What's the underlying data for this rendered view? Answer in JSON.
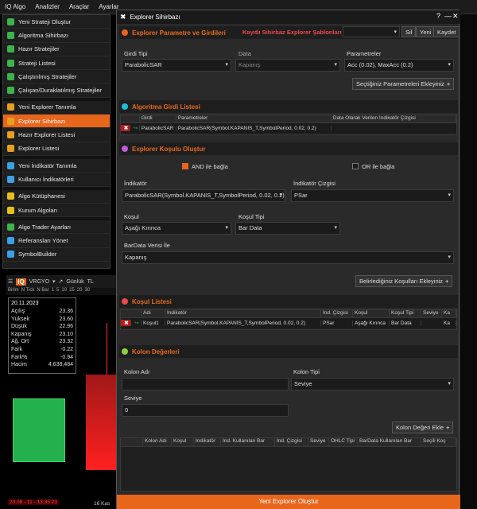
{
  "menubar": {
    "items": [
      "IQ Algo",
      "Analizler",
      "Araçlar",
      "Ayarlar"
    ]
  },
  "dropdown": {
    "items": [
      {
        "label": "Yeni Strateji Oluştur",
        "icon": "strategy-new-icon",
        "color": "#3cb44b"
      },
      {
        "label": "Algoritma Sihirbazı",
        "icon": "wizard-icon",
        "color": "#3cb44b"
      },
      {
        "label": "Hazır Stratejiler",
        "icon": "strategy-list-icon",
        "color": "#3cb44b"
      },
      {
        "label": "Strateji Listesi",
        "icon": "strategy-list-icon",
        "color": "#3cb44b"
      },
      {
        "label": "Çalıştırılmış Stratejiler",
        "icon": "run-icon",
        "color": "#3cb44b"
      },
      {
        "label": "Çalışan/Duraklatılmış Stratejiler",
        "icon": "pause-icon",
        "color": "#3cb44b"
      },
      {
        "label": "Yeni Explorer Tanımla",
        "icon": "explorer-new-icon",
        "color": "#e8a01c"
      },
      {
        "label": "Explorer Sihirbazı",
        "icon": "explorer-wizard-icon",
        "color": "#e8a01c"
      },
      {
        "label": "Hazır Explorer Listesi",
        "icon": "explorer-list-icon",
        "color": "#e8a01c"
      },
      {
        "label": "Explorer Listesi",
        "icon": "explorer-list-icon",
        "color": "#e8a01c"
      },
      {
        "label": "Yeni İndikatör Tanımla",
        "icon": "indicator-new-icon",
        "color": "#3ca0e8"
      },
      {
        "label": "Kullanıcı İndikatörleri",
        "icon": "indicator-user-icon",
        "color": "#3ca0e8"
      },
      {
        "label": "Algo Kütüphanesi",
        "icon": "library-icon",
        "color": "#e8c01c"
      },
      {
        "label": "Kurum Algoları",
        "icon": "institution-icon",
        "color": "#e8c01c"
      },
      {
        "label": "Algo Trader Ayarları",
        "icon": "settings-icon",
        "color": "#3cb44b"
      },
      {
        "label": "Referansları Yönet",
        "icon": "references-icon",
        "color": "#3ca0e8"
      },
      {
        "label": "SymbolBuilder",
        "icon": "symbol-builder-icon",
        "color": "#3ca0e8"
      }
    ]
  },
  "chart": {
    "logo": "IQ",
    "symbol": "VRGYO",
    "period": "Günlük",
    "currency": "TL",
    "cols": [
      "Birim",
      "N Tick",
      "N Bar",
      "1",
      "5",
      "10",
      "15",
      "20",
      "30"
    ],
    "date": "20.11.2023",
    "quote": [
      {
        "k": "Açılış",
        "v": "23.36"
      },
      {
        "k": "Yüksek",
        "v": "23.60"
      },
      {
        "k": "Düşük",
        "v": "22.96"
      },
      {
        "k": "Kapanış",
        "v": "23.10"
      },
      {
        "k": "Ağ. Ort",
        "v": "23.32"
      },
      {
        "k": "Fark",
        "v": "-0.22"
      },
      {
        "k": "Fark%",
        "v": "-0.94"
      },
      {
        "k": "Hacim",
        "v": "4,638,484"
      }
    ],
    "bottom_date": "23.08 - 11 - 13:35:23",
    "bottom_right": "16 Kas"
  },
  "dialog": {
    "title": "Explorer Sihirbazı",
    "help": "?",
    "minimize": "—",
    "close": "✕",
    "params_section": {
      "title": "Explorer Parametre ve Girdileri",
      "saved_label": "Kayıtlı Sihirbaz Explorer Şablonları",
      "buttons": [
        "Sil",
        "Yeni",
        "Kaydet"
      ],
      "col_data_type": "Girdi Tipi",
      "col_data": "Data",
      "col_params": "Parametreler",
      "data_type_value": "ParabolicSAR",
      "data_value": "Kapanış",
      "params_value": "Acc (0.02), MaxAcc (0.2)",
      "add_button": "Seçtiğiniz Parametreleri Ekleyiniz"
    },
    "algo_section": {
      "title": "Algoritma Girdi Listesi",
      "headers": [
        "Girdi",
        "Parametreler",
        "Data Olarak Verilen İndikatör Çizgisi"
      ],
      "row": [
        "ParabolicSAR",
        "ParabolicSAR(Symbol.KAPANIS_T,SymbolPeriod, 0.02, 0.2)",
        ""
      ]
    },
    "cond_section": {
      "title": "Explorer Koşulu Oluştur",
      "and_label": "AND ile bağla",
      "or_label": "OR ile bağla",
      "indicator_label": "İndikatör",
      "indicator_value": "ParabolicSAR(Symbol.KAPANIS_T,SymbolPeriod, 0.02, 0.2)",
      "line_label": "İndikatör Çizgisi",
      "line_value": "PSar",
      "cond_label": "Koşul",
      "cond_value": "Aşağı Kırınca",
      "cond_type_label": "Koşul Tipi",
      "cond_type_value": "Bar Data",
      "bardata_label": "BarData Verisi İle",
      "bardata_value": "Kapanış",
      "add_button": "Belirlediğiniz Koşulları Ekleyiniz"
    },
    "cond_list": {
      "title": "Koşul Listesi",
      "headers": [
        "Adı",
        "İndikatör",
        "İnd. Çizgisi",
        "Koşul",
        "Koşul Tipi",
        "Seviye",
        "Ka"
      ],
      "row": [
        "Koşul1",
        "ParabolicSAR(Symbol.KAPANIS_T,SymbolPeriod, 0.02, 0.2)",
        "PSar",
        "Aşağı Kırınca",
        "Bar Data",
        "",
        "Ka"
      ]
    },
    "col_values": {
      "title": "Kolon Değerleri",
      "col_name_label": "Kolon Adı",
      "col_name_value": "",
      "col_type_label": "Kolon Tipi",
      "col_type_value": "Seviye",
      "level_label": "Seviye",
      "level_value": "0",
      "add_button": "Kolon Değeri Ekle",
      "headers": [
        "Kolon Adı",
        "Koşul",
        "İndikatör",
        "İnd. Kullanılan Bar",
        "İnd. Çizgisi",
        "Seviye",
        "OHLC Tipi",
        "BarData Kullanılan Bar",
        "Seçili Koş"
      ]
    },
    "footer_button": "Yeni Explorer Oluştur"
  },
  "colors": {
    "accent": "#e8651c",
    "section_orange_dot": "#e8651c",
    "section_cyan_dot": "#1cbfd9",
    "section_purple_dot": "#c05ad9",
    "section_red_dot": "#e84a4a",
    "section_green_dot": "#8cd13c"
  }
}
